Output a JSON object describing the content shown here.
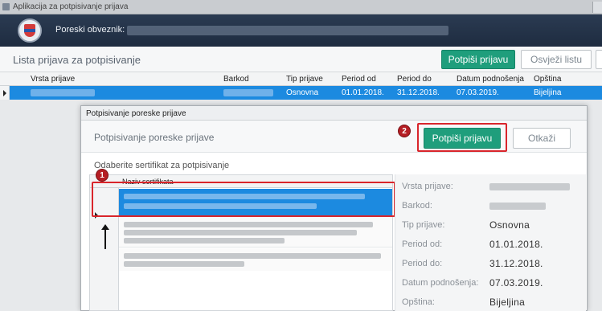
{
  "window": {
    "title": "Aplikacija za potpisivanje prijava"
  },
  "header": {
    "taxpayer_label": "Poreski obveznik:"
  },
  "toolbar": {
    "list_title": "Lista prijava za potpisivanje",
    "sign_label": "Potpiši prijavu",
    "refresh_label": "Osvježi listu"
  },
  "table": {
    "columns": [
      "Vrsta prijave",
      "Barkod",
      "Tip prijave",
      "Period od",
      "Period do",
      "Datum podnošenja",
      "Opština"
    ],
    "row": {
      "tip_prijave": "Osnovna",
      "period_od": "01.01.2018.",
      "period_do": "31.12.2018.",
      "datum": "07.03.2019.",
      "opstina": "Bijeljina"
    }
  },
  "modal": {
    "title": "Potpisivanje poreske prijave",
    "heading": "Potpisivanje poreske prijave",
    "sign_label": "Potpiši prijavu",
    "cancel_label": "Otkaži",
    "cert_caption": "Odaberite sertifikat za potpisivanje",
    "cert_column": "Naziv sertifikata",
    "badge_1": "1",
    "badge_2": "2",
    "details": {
      "vrsta_label": "Vrsta prijave:",
      "barkod_label": "Barkod:",
      "tip_label": "Tip prijave:",
      "tip_value": "Osnovna",
      "period_od_label": "Period od:",
      "period_od_value": "01.01.2018.",
      "period_do_label": "Period do:",
      "period_do_value": "31.12.2018.",
      "datum_label": "Datum podnošenja:",
      "datum_value": "07.03.2019.",
      "opstina_label": "Opština:",
      "opstina_value": "Bijeljina"
    }
  },
  "colors": {
    "accent_green": "#1f9e7c",
    "selection_blue": "#1c8ae0",
    "annotation_red": "#d9252b",
    "header_dark": "#1e2c40"
  },
  "icons": [
    "coat-of-arms-logo",
    "row-pointer-icon",
    "pointer-arrow-icon"
  ]
}
